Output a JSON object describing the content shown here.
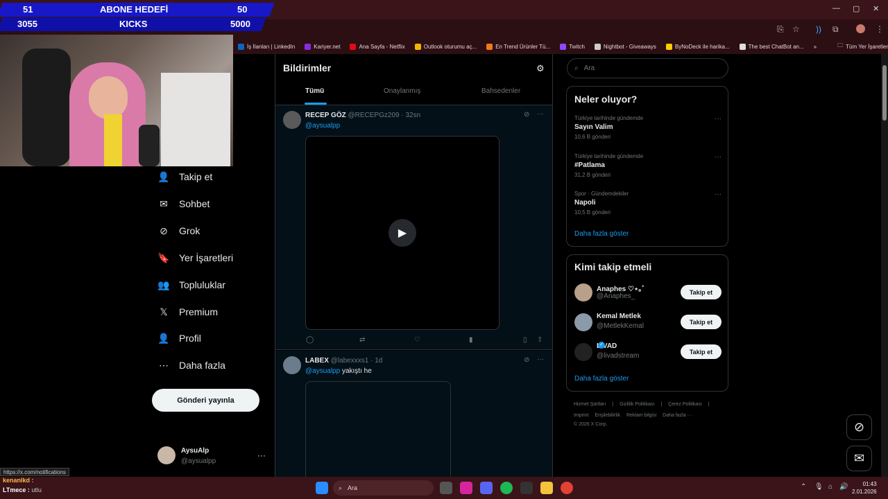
{
  "overlay": {
    "row1": {
      "left": "51",
      "label": "ABONE HEDEFİ",
      "right": "50"
    },
    "row2": {
      "left": "3055",
      "label": "KICKS",
      "right": "5000"
    }
  },
  "bookmarks": [
    {
      "label": "İş İlanları | LinkedIn",
      "color": "#0a66c2"
    },
    {
      "label": "Kariyer.net",
      "color": "#8a2be2"
    },
    {
      "label": "Ana Sayfa - Netflix",
      "color": "#e50914"
    },
    {
      "label": "Outlook oturumu aç...",
      "color": "#f4b400"
    },
    {
      "label": "En Trend Ürünler Tü...",
      "color": "#f27a1a"
    },
    {
      "label": "Twitch",
      "color": "#9146ff"
    },
    {
      "label": "Nightbot - Giveaways",
      "color": "#cccccc"
    },
    {
      "label": "ByNoDeck ile harika...",
      "color": "#ffcc00"
    },
    {
      "label": "The best ChatBot an...",
      "color": "#dddddd"
    }
  ],
  "bookmarks_more": "»",
  "bookmarks_all": "Tüm Yer İşaretleri",
  "nav": [
    {
      "label": "Takip et",
      "icon": "person-add-icon",
      "glyph": "👤"
    },
    {
      "label": "Sohbet",
      "icon": "mail-icon",
      "glyph": "✉"
    },
    {
      "label": "Grok",
      "icon": "grok-icon",
      "glyph": "⊘"
    },
    {
      "label": "Yer İşaretleri",
      "icon": "bookmark-icon",
      "glyph": "🔖"
    },
    {
      "label": "Topluluklar",
      "icon": "communities-icon",
      "glyph": "👥"
    },
    {
      "label": "Premium",
      "icon": "x-logo-icon",
      "glyph": "𝕏"
    },
    {
      "label": "Profil",
      "icon": "profile-icon",
      "glyph": "👤"
    },
    {
      "label": "Daha fazla",
      "icon": "more-circle-icon",
      "glyph": "⋯"
    }
  ],
  "post_button": "Gönderi yayınla",
  "account": {
    "name": "AysuAlp",
    "handle": "@aysualpp",
    "dots": "···"
  },
  "notifications": {
    "title": "Bildirimler",
    "tabs": [
      "Tümü",
      "Onaylanmış",
      "Bahsedenler"
    ]
  },
  "tweets": [
    {
      "name": "RECEP GÖZ",
      "handle": "@RECEPGz209",
      "time": "· 32sn",
      "mention": "@aysualpp",
      "text": ""
    },
    {
      "name": "LABEX",
      "handle": "@labexxxs1",
      "time": "· 1d",
      "mention": "@aysualpp",
      "text": " yakıştı he"
    }
  ],
  "search": {
    "placeholder": "Ara"
  },
  "trends": {
    "title": "Neler oluyor?",
    "items": [
      {
        "meta": "Türkiye tarihinde gündemde",
        "title": "Sayın Valim",
        "count": "10,6 B gönderi"
      },
      {
        "meta": "Türkiye tarihinde gündemde",
        "title": "#Patlama",
        "count": "31,2 B gönderi"
      },
      {
        "meta": "Spor · Gündemdekiler",
        "title": "Napoli",
        "count": "10,5 B gönderi"
      }
    ],
    "more": "Daha fazla göster"
  },
  "who_to_follow": {
    "title": "Kimi takip etmeli",
    "items": [
      {
        "name": "Anaphes ♡⋆｡˚",
        "handle": "@Anaphes_",
        "button": "Takip et",
        "color": "#b8a08a"
      },
      {
        "name": "Kemal Metlek",
        "handle": "@MetlekKemal",
        "button": "Takip et",
        "color": "#8a9aa8"
      },
      {
        "name": "LIVAD",
        "handle": "@livadstream",
        "button": "Takip et",
        "color": "#222222"
      }
    ],
    "more": "Daha fazla göster"
  },
  "footer": {
    "line1": [
      "Hizmet Şartları",
      "Gizlilik Politikası",
      "Çerez Politikası"
    ],
    "line2": [
      "Imprint",
      "Erişilebilirlik",
      "Reklam bilgisi",
      "Daha fazla ···"
    ],
    "copyright": "© 2026 X Corp."
  },
  "status_url": "https://x.com/notifications",
  "chat": {
    "line1": "kenanlkd :",
    "line2": "LTmece :",
    "line2_extra": "utlu"
  },
  "taskbar": {
    "search": "Ara",
    "time": "01:43",
    "date": "2.01.2026"
  },
  "colors": {
    "accent": "#1d9bf0",
    "titlebar": "#3a1418",
    "overlay": "#1818c8"
  }
}
